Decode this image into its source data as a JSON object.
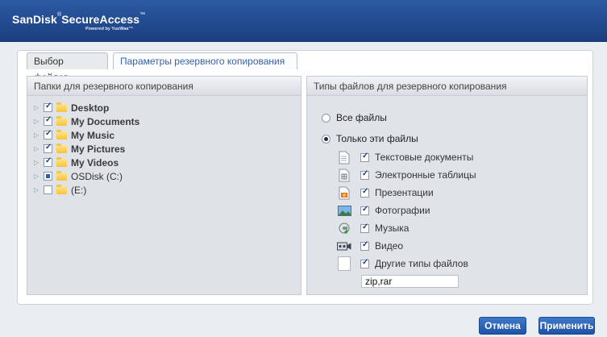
{
  "header": {
    "brand_a": "SanDisk",
    "brand_reg": "®",
    "brand_b": "SecureAccess",
    "brand_tm": "™",
    "powered": "Powered by YuuWaa™"
  },
  "tabs": [
    {
      "label": "Выбор файлов"
    },
    {
      "label": "Параметры резервного копирования"
    }
  ],
  "left_panel": {
    "title": "Папки для резервного копирования",
    "folders": [
      {
        "label": "Desktop",
        "state": "checked"
      },
      {
        "label": "My Documents",
        "state": "checked"
      },
      {
        "label": "My Music",
        "state": "checked"
      },
      {
        "label": "My Pictures",
        "state": "checked"
      },
      {
        "label": "My Videos",
        "state": "checked"
      },
      {
        "label": "OSDisk (C:)",
        "state": "partial"
      },
      {
        "label": "(E:)",
        "state": "unchecked"
      }
    ]
  },
  "right_panel": {
    "title": "Типы файлов для резервного копирования",
    "all_files": "Все файлы",
    "only_these": "Только эти файлы",
    "types": [
      {
        "label": "Текстовые документы",
        "icon": "text-document-icon"
      },
      {
        "label": "Электронные таблицы",
        "icon": "spreadsheet-icon"
      },
      {
        "label": "Презентации",
        "icon": "presentation-icon"
      },
      {
        "label": "Фотографии",
        "icon": "photo-icon"
      },
      {
        "label": "Музыка",
        "icon": "music-icon"
      },
      {
        "label": "Видео",
        "icon": "video-icon"
      },
      {
        "label": "Другие типы файлов",
        "icon": "blank-file-icon"
      }
    ],
    "extensions_value": "zip,rar"
  },
  "buttons": {
    "cancel": "Отмена",
    "apply": "Применить"
  },
  "colors": {
    "header": "#1f4a92",
    "button": "#2a62b8",
    "tab_link": "#3a62a8"
  }
}
